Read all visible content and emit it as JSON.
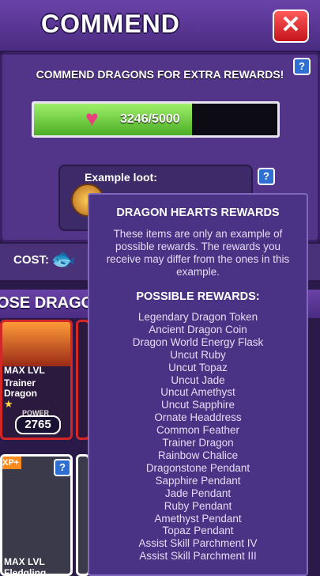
{
  "header": {
    "title": "COMMEND",
    "close_icon": "close-icon",
    "close_glyph": "✕"
  },
  "commend_panel": {
    "heading": "COMMEND DRAGONS FOR EXTRA REWARDS!",
    "help_glyph": "?",
    "progress": {
      "current": 3246,
      "max": 5000,
      "text": "3246/5000",
      "fraction": 0.6492,
      "icon": "dragon-heart-icon"
    },
    "example_loot_label": "Example loot:"
  },
  "cost": {
    "label": "COST:",
    "icon": "fish-food-icon"
  },
  "choose_banner": {
    "text": "OSE DRAGO"
  },
  "dragon_cards": [
    {
      "level": "MAX LVL",
      "name_line1": "Trainer",
      "name_line2": "Dragon",
      "power_label": "POWER",
      "power": "2765",
      "stars": "★"
    },
    {
      "level": "MAX LVL",
      "name_line1": "Fledgling",
      "xp_badge": "XP+"
    }
  ],
  "tooltip": {
    "title": "DRAGON HEARTS REWARDS",
    "description": "These items are only an example of possible rewards. The rewards you receive may differ from the ones in this example.",
    "subtitle": "POSSIBLE REWARDS:",
    "rewards": [
      "Legendary Dragon Token",
      "Ancient Dragon Coin",
      "Dragon World Energy Flask",
      "Uncut Ruby",
      "Uncut Topaz",
      "Uncut Jade",
      "Uncut Amethyst",
      "Uncut Sapphire",
      "Ornate Headdress",
      "Common Feather",
      "Trainer Dragon",
      "Rainbow Chalice",
      "Dragonstone Pendant",
      "Sapphire Pendant",
      "Jade Pendant",
      "Ruby Pendant",
      "Amethyst Pendant",
      "Topaz Pendant",
      "Assist Skill Parchment IV",
      "Assist Skill Parchment III"
    ]
  },
  "colors": {
    "progress_fill": "#6fd13b",
    "close_button": "#e02a2a",
    "tooltip_bg": "#4a3284",
    "card_border": "#d42626"
  }
}
